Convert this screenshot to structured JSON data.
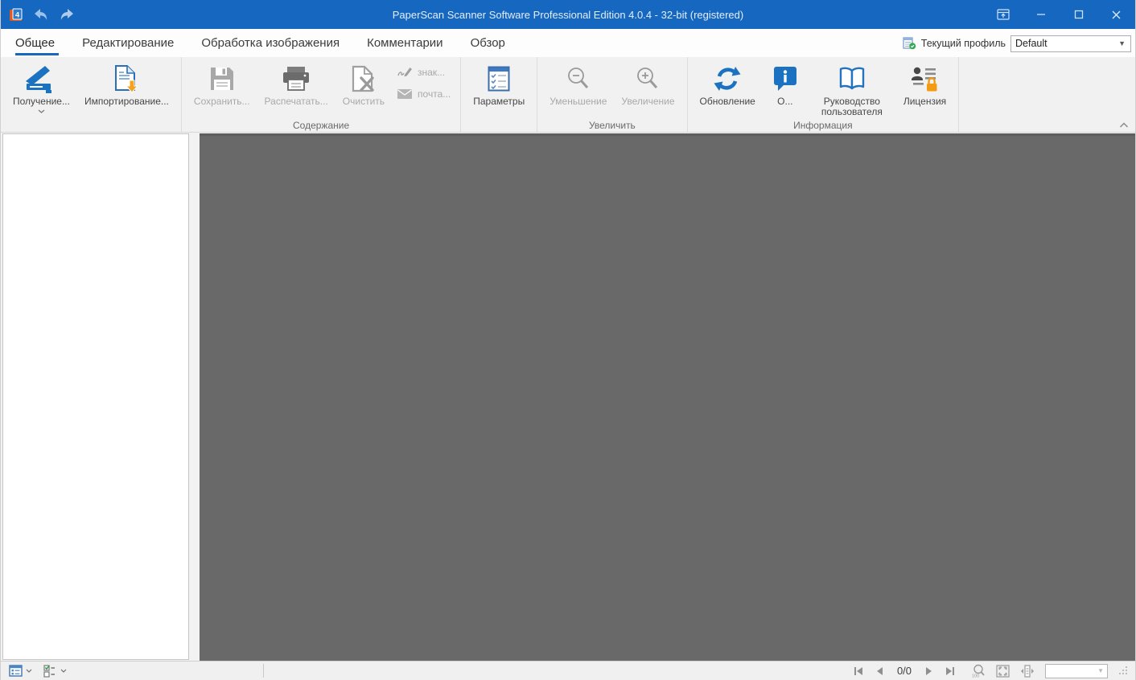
{
  "colors": {
    "titlebar_blue": "#1567c0",
    "accent_blue": "#1567c0",
    "icon_blue": "#1b72c0",
    "orange": "#f39c12",
    "canvas_gray": "#696969",
    "ribbon_bg": "#f1f1f1",
    "disabled_text": "#a9a9a9"
  },
  "titlebar": {
    "title": "PaperScan Scanner Software Professional Edition 4.0.4 - 32-bit (registered)"
  },
  "tabs": [
    {
      "label": "Общее",
      "selected": true
    },
    {
      "label": "Редактирование",
      "selected": false
    },
    {
      "label": "Обработка изображения",
      "selected": false
    },
    {
      "label": "Комментарии",
      "selected": false
    },
    {
      "label": "Обзор",
      "selected": false
    }
  ],
  "profile": {
    "label": "Текущий профиль",
    "value": "Default"
  },
  "ribbon": {
    "groups": [
      {
        "caption": "",
        "buttons": [
          {
            "label": "Получение...",
            "icon": "scanner-icon",
            "enabled": true,
            "split": true
          },
          {
            "label": "Импортирование...",
            "icon": "import-document-icon",
            "enabled": true
          }
        ]
      },
      {
        "caption": "Содержание",
        "buttons": [
          {
            "label": "Сохранить...",
            "icon": "save-floppy-icon",
            "enabled": false
          },
          {
            "label": "Распечатать...",
            "icon": "printer-icon",
            "enabled": false
          },
          {
            "label": "Очистить",
            "icon": "clear-document-icon",
            "enabled": false
          }
        ],
        "small_buttons": [
          {
            "label": "знак...",
            "icon": "signature-icon",
            "enabled": false
          },
          {
            "label": "почта...",
            "icon": "mail-envelope-icon",
            "enabled": false
          }
        ]
      },
      {
        "caption": "",
        "buttons": [
          {
            "label": "Параметры",
            "icon": "options-checklist-icon",
            "enabled": true
          }
        ]
      },
      {
        "caption": "Увеличить",
        "buttons": [
          {
            "label": "Уменьшение",
            "icon": "zoom-out-icon",
            "enabled": false
          },
          {
            "label": "Увеличение",
            "icon": "zoom-in-icon",
            "enabled": false
          }
        ]
      },
      {
        "caption": "Информация",
        "buttons": [
          {
            "label": "Обновление",
            "icon": "refresh-icon",
            "enabled": true
          },
          {
            "label": "О...",
            "icon": "about-info-icon",
            "enabled": true
          },
          {
            "label": "Руководство пользователя",
            "icon": "user-guide-book-icon",
            "enabled": true
          },
          {
            "label": "Лицензия",
            "icon": "license-lock-icon",
            "enabled": true
          }
        ]
      }
    ]
  },
  "statusbar": {
    "page_indicator": "0/0",
    "zoom_value": ""
  }
}
